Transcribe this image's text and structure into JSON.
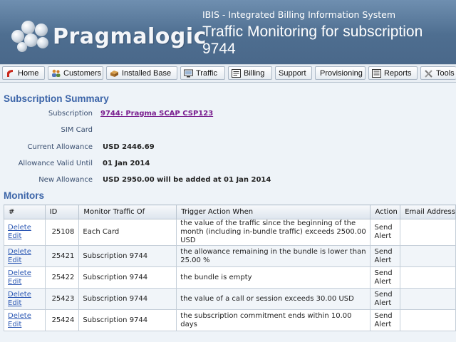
{
  "header": {
    "brand": "Pragmalogic",
    "system_name": "IBIS - Integrated Billing Information System",
    "page_title": "Traffic Monitoring for subscription 9744"
  },
  "nav": {
    "items": [
      {
        "label": "Home",
        "icon": "home-icon"
      },
      {
        "label": "Customers",
        "icon": "people-icon"
      },
      {
        "label": "Installed Base",
        "icon": "box-icon"
      },
      {
        "label": "Traffic",
        "icon": "monitor-icon"
      },
      {
        "label": "Billing",
        "icon": "document-icon"
      },
      {
        "label": "Support",
        "icon": ""
      },
      {
        "label": "Provisioning",
        "icon": ""
      },
      {
        "label": "Reports",
        "icon": "report-icon"
      },
      {
        "label": "Tools",
        "icon": "wrench-icon"
      }
    ]
  },
  "summary": {
    "title": "Subscription Summary",
    "subscription_label": "Subscription",
    "subscription_value": "9744: Pragma SCAP CSP123",
    "sim_label": "SIM Card",
    "sim_value": "",
    "allowance_label": "Current Allowance",
    "allowance_value": "USD 2446.69",
    "valid_label": "Allowance Valid Until",
    "valid_value": "01 Jan 2014",
    "new_label": "New Allowance",
    "new_value": "USD 2950.00 will be added at 01 Jan 2014"
  },
  "monitors": {
    "title": "Monitors",
    "headers": {
      "num": "#",
      "id": "ID",
      "monitor_of": "Monitor Traffic Of",
      "trigger": "Trigger Action When",
      "action": "Action",
      "email": "Email Address"
    },
    "delete_label": "Delete",
    "edit_label": "Edit",
    "rows": [
      {
        "id": "25108",
        "monitor_of": "Each Card",
        "trigger": "the value of the traffic since the beginning of the month (including in-bundle traffic) exceeds 2500.00 USD",
        "action": "Send Alert",
        "email": ""
      },
      {
        "id": "25421",
        "monitor_of": "Subscription 9744",
        "trigger": "the allowance remaining in the bundle is lower than 25.00 %",
        "action": "Send Alert",
        "email": ""
      },
      {
        "id": "25422",
        "monitor_of": "Subscription 9744",
        "trigger": "the bundle is empty",
        "action": "Send Alert",
        "email": ""
      },
      {
        "id": "25423",
        "monitor_of": "Subscription 9744",
        "trigger": "the value of a call or session exceeds 30.00 USD",
        "action": "Send Alert",
        "email": ""
      },
      {
        "id": "25424",
        "monitor_of": "Subscription 9744",
        "trigger": "the subscription commitment ends within 10.00 days",
        "action": "Send Alert",
        "email": ""
      }
    ]
  }
}
